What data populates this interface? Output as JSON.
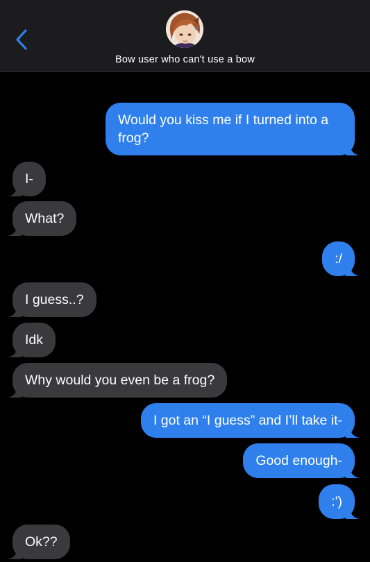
{
  "header": {
    "contact_name": "Bow user who can't use a bow"
  },
  "icons": {
    "back": "chevron-left-icon",
    "avatar": "contact-avatar"
  },
  "colors": {
    "sent": "#2f80ed",
    "received": "#3a3a3c",
    "accent": "#2f80ed",
    "background": "#000000"
  },
  "messages": [
    {
      "from": "me",
      "text": "Would you kiss me if I turned into a frog?"
    },
    {
      "from": "them",
      "text": "I-"
    },
    {
      "from": "them",
      "text": "What?"
    },
    {
      "from": "me",
      "text": ":/"
    },
    {
      "from": "them",
      "text": "I guess..?"
    },
    {
      "from": "them",
      "text": "Idk"
    },
    {
      "from": "them",
      "text": "Why would you even be a frog?"
    },
    {
      "from": "me",
      "text": "I got an “I guess” and I’ll take it-"
    },
    {
      "from": "me",
      "text": "Good enough-"
    },
    {
      "from": "me",
      "text": ":')"
    },
    {
      "from": "them",
      "text": "Ok??"
    }
  ]
}
